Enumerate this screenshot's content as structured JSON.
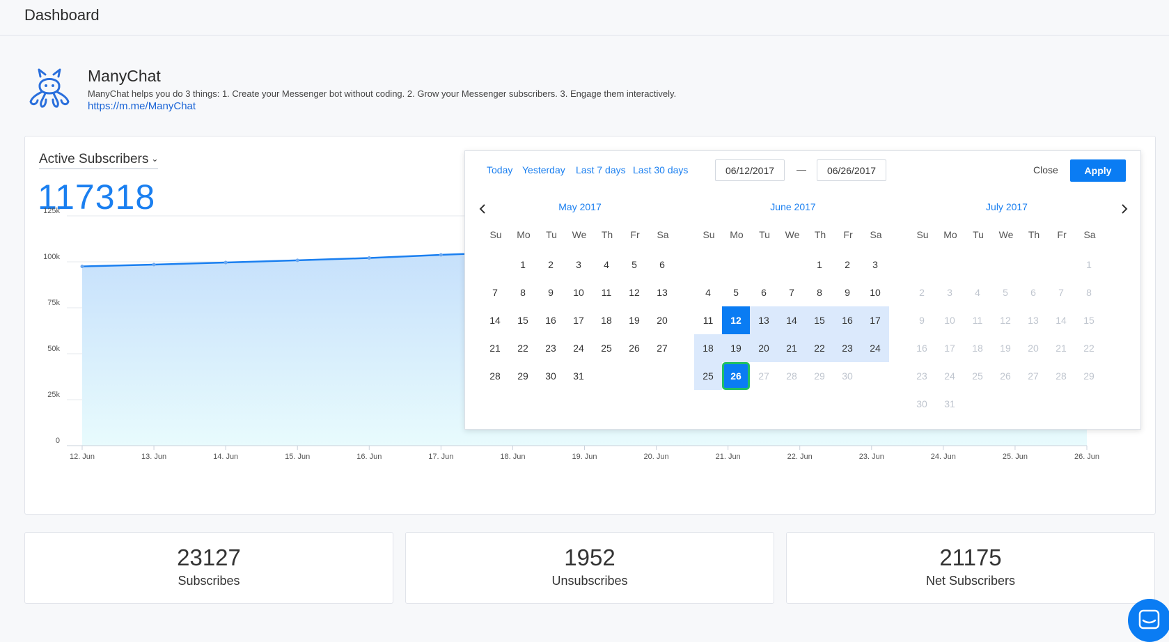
{
  "header": {
    "title": "Dashboard"
  },
  "page": {
    "name": "ManyChat",
    "description": "ManyChat helps you do 3 things: 1. Create your Messenger bot without coding. 2. Grow your Messenger subscribers. 3. Engage them interactively.",
    "link": "https://m.me/ManyChat",
    "logo_icon": "octopus-logo-icon"
  },
  "metric": {
    "selected": "Active Subscribers",
    "value": "117318"
  },
  "chart_data": {
    "type": "area",
    "title": "",
    "xlabel": "",
    "ylabel": "",
    "ylim": [
      0,
      125000
    ],
    "y_ticks": [
      "0",
      "25k",
      "50k",
      "75k",
      "100k",
      "125k"
    ],
    "categories": [
      "12. Jun",
      "13. Jun",
      "14. Jun",
      "15. Jun",
      "16. Jun",
      "17. Jun",
      "18. Jun",
      "19. Jun",
      "20. Jun",
      "21. Jun",
      "22. Jun",
      "23. Jun",
      "24. Jun",
      "25. Jun",
      "26. Jun"
    ],
    "series": [
      {
        "values": [
          97500,
          98500,
          99600,
          100800,
          102100,
          103800,
          105200,
          106700,
          108300,
          110000,
          111800,
          113500,
          115200,
          116800,
          117318
        ]
      }
    ],
    "line_color": "#1a7ff0",
    "fill_top": "#c2ddfb",
    "fill_bottom": "#e8fbfd",
    "grid": true
  },
  "stats": [
    {
      "value": "23127",
      "label": "Subscribes"
    },
    {
      "value": "1952",
      "label": "Unsubscribes"
    },
    {
      "value": "21175",
      "label": "Net Subscribers"
    }
  ],
  "datepicker": {
    "presets": [
      "Today",
      "Yesterday",
      "Last 7 days",
      "Last 30 days"
    ],
    "start": "06/12/2017",
    "end": "06/26/2017",
    "separator": "—",
    "close_label": "Close",
    "apply_label": "Apply",
    "weekdays": [
      "Su",
      "Mo",
      "Tu",
      "We",
      "Th",
      "Fr",
      "Sa"
    ],
    "months": [
      {
        "title": "May 2017",
        "first_weekday": 1,
        "days": 31,
        "range": [],
        "selected": [],
        "today": null,
        "muted_after": null,
        "muted_all": false
      },
      {
        "title": "June 2017",
        "first_weekday": 4,
        "days": 30,
        "range": [
          12,
          26
        ],
        "selected": [
          12,
          26
        ],
        "today": 26,
        "muted_after": 26,
        "muted_all": false
      },
      {
        "title": "July 2017",
        "first_weekday": 6,
        "days": 31,
        "range": [],
        "selected": [],
        "today": null,
        "muted_after": null,
        "muted_all": true
      }
    ]
  },
  "chat_widget": {
    "icon": "chat-bubble-icon"
  },
  "colors": {
    "accent": "#0a7cf3",
    "range": "#dbe9fc",
    "today_ring": "#21c063"
  }
}
